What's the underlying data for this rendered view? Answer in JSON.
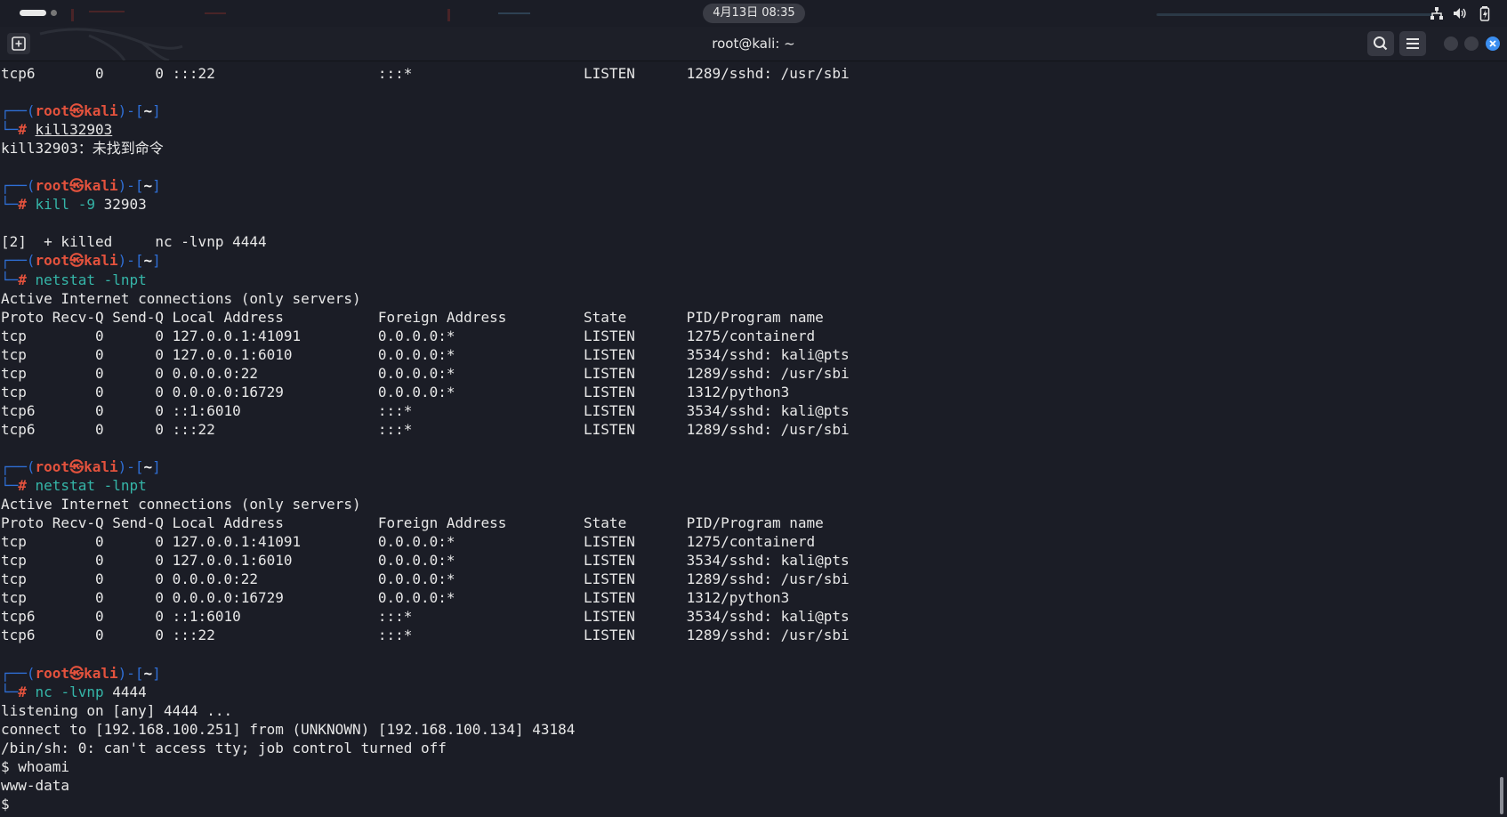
{
  "system_panel": {
    "clock": "4月13日  08:35",
    "icons": [
      "network-icon",
      "volume-icon",
      "battery-icon"
    ]
  },
  "window": {
    "title": "root@kali: ~",
    "buttons": [
      "new-tab-icon",
      "search-icon",
      "menu-icon",
      "minimize",
      "maximize",
      "close-icon"
    ]
  },
  "colors": {
    "background": "#1b1d26",
    "prompt_bracket": "#2f6fd6",
    "prompt_user": "#e3523d",
    "command": "#35b5a8",
    "text": "#e7e7e7",
    "close_button": "#3b8ef0"
  },
  "prompt": {
    "user": "root",
    "at": "㉿",
    "host": "kali",
    "dir": "~"
  },
  "terminal": {
    "lines": [
      {
        "kind": "out",
        "text": "tcp6       0      0 :::22                   :::*                    LISTEN      1289/sshd: /usr/sbi"
      },
      {
        "kind": "out",
        "text": ""
      },
      {
        "kind": "prompt"
      },
      {
        "kind": "cmd",
        "cmd": "kill32903",
        "underline": true,
        "flag": "",
        "args": ""
      },
      {
        "kind": "out",
        "text": "kill32903：未找到命令"
      },
      {
        "kind": "out",
        "text": ""
      },
      {
        "kind": "prompt"
      },
      {
        "kind": "cmd",
        "cmd": "kill",
        "underline": false,
        "flag": "-9",
        "args": "32903"
      },
      {
        "kind": "out",
        "text": ""
      },
      {
        "kind": "out",
        "text": "[2]  + killed     nc -lvnp 4444"
      },
      {
        "kind": "prompt"
      },
      {
        "kind": "cmd",
        "cmd": "netstat",
        "underline": false,
        "flag": "-lnpt",
        "args": ""
      },
      {
        "kind": "out",
        "text": "Active Internet connections (only servers)"
      },
      {
        "kind": "out",
        "text": "Proto Recv-Q Send-Q Local Address           Foreign Address         State       PID/Program name"
      },
      {
        "kind": "out",
        "text": "tcp        0      0 127.0.0.1:41091         0.0.0.0:*               LISTEN      1275/containerd"
      },
      {
        "kind": "out",
        "text": "tcp        0      0 127.0.0.1:6010          0.0.0.0:*               LISTEN      3534/sshd: kali@pts"
      },
      {
        "kind": "out",
        "text": "tcp        0      0 0.0.0.0:22              0.0.0.0:*               LISTEN      1289/sshd: /usr/sbi"
      },
      {
        "kind": "out",
        "text": "tcp        0      0 0.0.0.0:16729           0.0.0.0:*               LISTEN      1312/python3"
      },
      {
        "kind": "out",
        "text": "tcp6       0      0 ::1:6010                :::*                    LISTEN      3534/sshd: kali@pts"
      },
      {
        "kind": "out",
        "text": "tcp6       0      0 :::22                   :::*                    LISTEN      1289/sshd: /usr/sbi"
      },
      {
        "kind": "out",
        "text": ""
      },
      {
        "kind": "prompt"
      },
      {
        "kind": "cmd",
        "cmd": "netstat",
        "underline": false,
        "flag": "-lnpt",
        "args": ""
      },
      {
        "kind": "out",
        "text": "Active Internet connections (only servers)"
      },
      {
        "kind": "out",
        "text": "Proto Recv-Q Send-Q Local Address           Foreign Address         State       PID/Program name"
      },
      {
        "kind": "out",
        "text": "tcp        0      0 127.0.0.1:41091         0.0.0.0:*               LISTEN      1275/containerd"
      },
      {
        "kind": "out",
        "text": "tcp        0      0 127.0.0.1:6010          0.0.0.0:*               LISTEN      3534/sshd: kali@pts"
      },
      {
        "kind": "out",
        "text": "tcp        0      0 0.0.0.0:22              0.0.0.0:*               LISTEN      1289/sshd: /usr/sbi"
      },
      {
        "kind": "out",
        "text": "tcp        0      0 0.0.0.0:16729           0.0.0.0:*               LISTEN      1312/python3"
      },
      {
        "kind": "out",
        "text": "tcp6       0      0 ::1:6010                :::*                    LISTEN      3534/sshd: kali@pts"
      },
      {
        "kind": "out",
        "text": "tcp6       0      0 :::22                   :::*                    LISTEN      1289/sshd: /usr/sbi"
      },
      {
        "kind": "out",
        "text": ""
      },
      {
        "kind": "prompt"
      },
      {
        "kind": "cmd",
        "cmd": "nc",
        "underline": false,
        "flag": "-lvnp",
        "args": "4444"
      },
      {
        "kind": "out",
        "text": "listening on [any] 4444 ..."
      },
      {
        "kind": "out",
        "text": "connect to [192.168.100.251] from (UNKNOWN) [192.168.100.134] 43184"
      },
      {
        "kind": "out",
        "text": "/bin/sh: 0: can't access tty; job control turned off"
      },
      {
        "kind": "out",
        "text": "$ whoami"
      },
      {
        "kind": "out",
        "text": "www-data"
      },
      {
        "kind": "out",
        "text": "$ "
      }
    ]
  }
}
